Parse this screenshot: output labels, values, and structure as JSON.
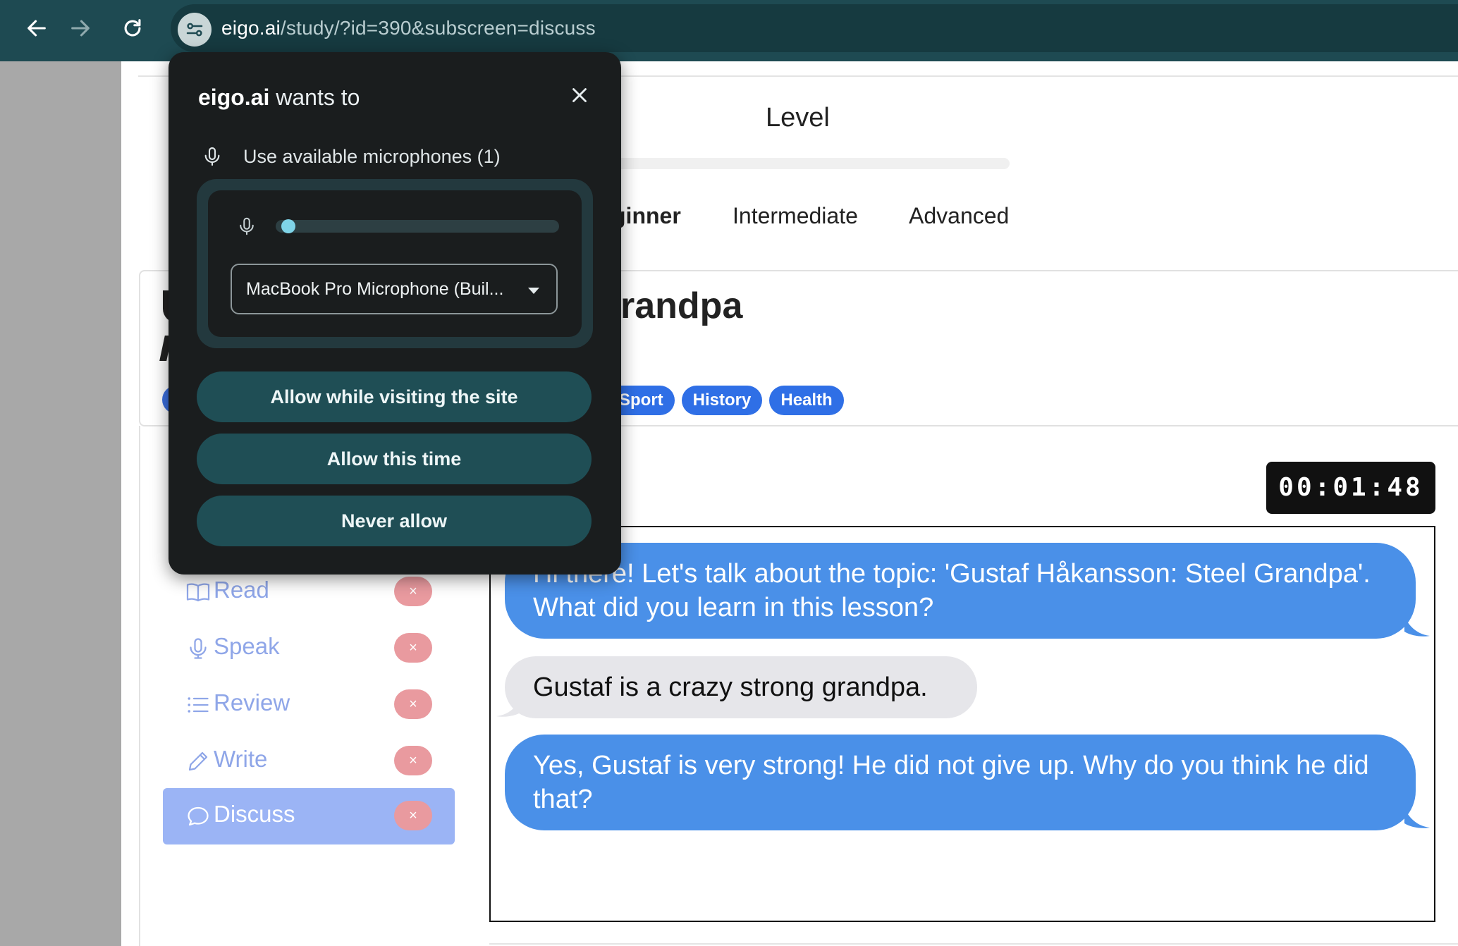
{
  "browser": {
    "url_host": "eigo.ai",
    "url_path": "/study/?id=390&subscreen=discuss"
  },
  "level": {
    "title": "Level",
    "options": [
      "ginner",
      "Intermediate",
      "Advanced"
    ],
    "active_index": 0
  },
  "lesson": {
    "title_fragment": "randpa",
    "tags": [
      "Sport",
      "History",
      "Health"
    ]
  },
  "nav": [
    {
      "label": "Read",
      "icon": "book-icon"
    },
    {
      "label": "Speak",
      "icon": "microphone-icon"
    },
    {
      "label": "Review",
      "icon": "list-icon"
    },
    {
      "label": "Write",
      "icon": "pencil-icon"
    },
    {
      "label": "Discuss",
      "icon": "chat-bubble-icon"
    }
  ],
  "nav_active_index": 4,
  "nav_remove_glyph": "×",
  "timer": "00:01:48",
  "chat": [
    {
      "role": "bot",
      "text": "Hi there! Let's talk about the topic: 'Gustaf Håkansson: Steel Grandpa'. What did you learn in this lesson?"
    },
    {
      "role": "user",
      "text": "Gustaf is a crazy strong grandpa."
    },
    {
      "role": "bot",
      "text": "Yes, Gustaf is very strong! He did not give up. Why do you think he did that?"
    }
  ],
  "dialog": {
    "site": "eigo.ai",
    "title_suffix": " wants to",
    "permission": "Use available microphones (1)",
    "mic_level": 0.02,
    "device": "MacBook Pro Microphone (Buil...",
    "buttons": [
      "Allow while visiting the site",
      "Allow this time",
      "Never allow"
    ]
  },
  "colors": {
    "chrome": "#1e4a52",
    "bubble_bot": "#4a90e8",
    "bubble_user": "#e6e6ea",
    "tag": "#2f6fe6",
    "nav_active": "#9bb4f5",
    "dialog_button": "#1f4e55"
  }
}
